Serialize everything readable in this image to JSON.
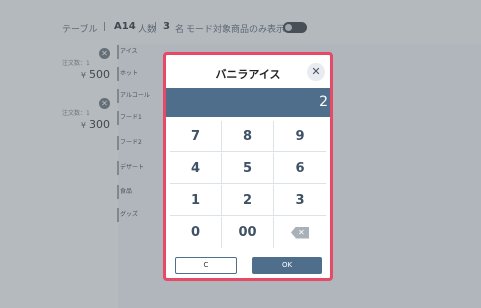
{
  "topbar": {
    "table_label": "テーブル",
    "sep": "|",
    "table_value": "A14",
    "people_label": "人数",
    "people_value": "3",
    "people_unit": "名",
    "mode_label": "モード対象商品のみ表示"
  },
  "orders": [
    {
      "label": "注文数：1",
      "yen": "¥",
      "price": "500"
    },
    {
      "label": "注文数：1",
      "yen": "¥",
      "price": "300"
    }
  ],
  "categories": [
    "アイス",
    "ホット",
    "アルコール",
    "フード1",
    "フード2",
    "デザート",
    "食品",
    "グッズ"
  ],
  "modal": {
    "title": "バニラアイス",
    "display_value": "2",
    "keys": [
      "7",
      "8",
      "9",
      "4",
      "5",
      "6",
      "1",
      "2",
      "3",
      "0",
      "00"
    ],
    "clear_label": "C",
    "ok_label": "OK"
  },
  "colors": {
    "accent": "#4f6e8c",
    "modal_border": "#e64a66"
  },
  "icons": {
    "close": "close-icon",
    "remove": "remove-icon",
    "backspace": "backspace-icon"
  }
}
